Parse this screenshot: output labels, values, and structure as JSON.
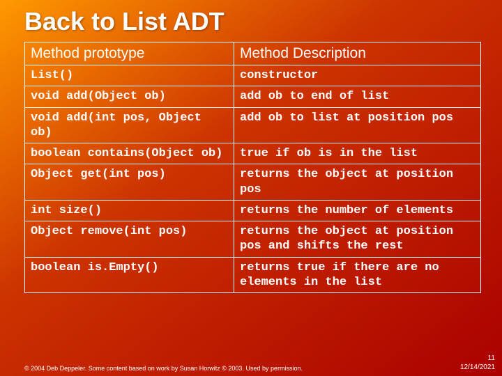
{
  "title": "Back to List ADT",
  "headers": {
    "proto": "Method prototype",
    "desc": "Method Description"
  },
  "rows": [
    {
      "proto": "List()",
      "desc": "constructor"
    },
    {
      "proto": "void add(Object ob)",
      "desc": "add ob to end of list"
    },
    {
      "proto": "void add(int pos, Object ob)",
      "desc": "add ob to list at position pos"
    },
    {
      "proto": "boolean contains(Object ob)",
      "desc": "true if ob is in the list"
    },
    {
      "proto": "Object get(int pos)",
      "desc": "returns the object at position pos"
    },
    {
      "proto": "int size()",
      "desc": "returns the number of elements"
    },
    {
      "proto": "Object remove(int pos)",
      "desc": "returns the object at position pos and shifts the rest"
    },
    {
      "proto": "boolean is.Empty()",
      "desc": "returns true if there are no elements in the list"
    }
  ],
  "footer": {
    "credit": "© 2004 Deb Deppeler.  Some content based on work by Susan Horwitz © 2003.  Used by permission.",
    "page": "11",
    "date": "12/14/2021"
  }
}
